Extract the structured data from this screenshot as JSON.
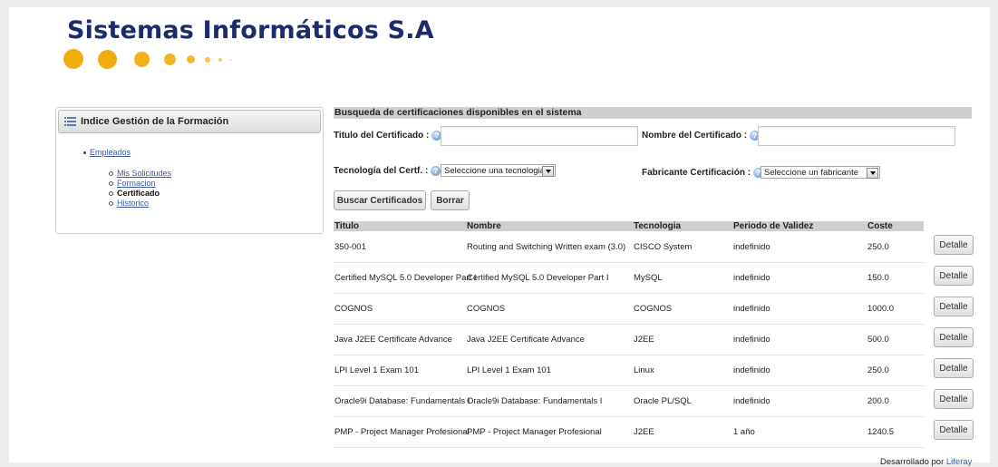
{
  "header": {
    "company": "Sistemas Informáticos S.A"
  },
  "sidebar": {
    "title": "Indice Gestión de la Formación",
    "root": "Empleados",
    "items": [
      {
        "label": "Mis Solicitudes",
        "type": "link"
      },
      {
        "label": "Formacion",
        "type": "link"
      },
      {
        "label": "Certificado",
        "type": "current"
      },
      {
        "label": "Historico",
        "type": "link"
      }
    ]
  },
  "search": {
    "title": "Busqueda de certificaciones disponibles en el sistema",
    "titulo_label": "Titulo del Certificado :",
    "titulo_value": "",
    "nombre_label": "Nombre del Certificado :",
    "nombre_value": "",
    "tecnologia_label": "Tecnología del Certf. :",
    "tecnologia_selected": "Seleccione una tecnologia",
    "fabricante_label": "Fabricante Certificación :",
    "fabricante_selected": "Seleccione un fabricante",
    "buscar_button": "Buscar Certificados",
    "borrar_button": "Borrar"
  },
  "results": {
    "columns": [
      "Titulo",
      "Nombre",
      "Tecnologia",
      "Periodo de Validez",
      "Coste"
    ],
    "detail_label": "Detalle",
    "rows": [
      [
        "350-001",
        "Routing and Switching Written exam (3.0)",
        "CISCO System",
        "indefinido",
        "250.0"
      ],
      [
        "Certified MySQL 5.0 Developer Part I",
        "Certified MySQL 5.0 Developer Part I",
        "MySQL",
        "indefinido",
        "150.0"
      ],
      [
        "COGNOS",
        "COGNOS",
        "COGNOS",
        "indefinido",
        "1000.0"
      ],
      [
        "Java J2EE Certificate Advance",
        "Java J2EE Certificate Advance",
        "J2EE",
        "indefinido",
        "500.0"
      ],
      [
        "LPI Level 1 Exam 101",
        "LPI Level 1 Exam 101",
        "Linux",
        "indefinido",
        "250.0"
      ],
      [
        "Oracle9i Database: Fundamentals I",
        "Oracle9i Database: Fundamentals I",
        "Oracle PL/SQL",
        "indefinido",
        "200.0"
      ],
      [
        "PMP - Project Manager Profesional",
        "PMP - Project Manager Profesional",
        "J2EE",
        "1 año",
        "1240.5"
      ]
    ]
  },
  "footer": {
    "prefix": "Desarrollado por",
    "link": "Liferay"
  }
}
